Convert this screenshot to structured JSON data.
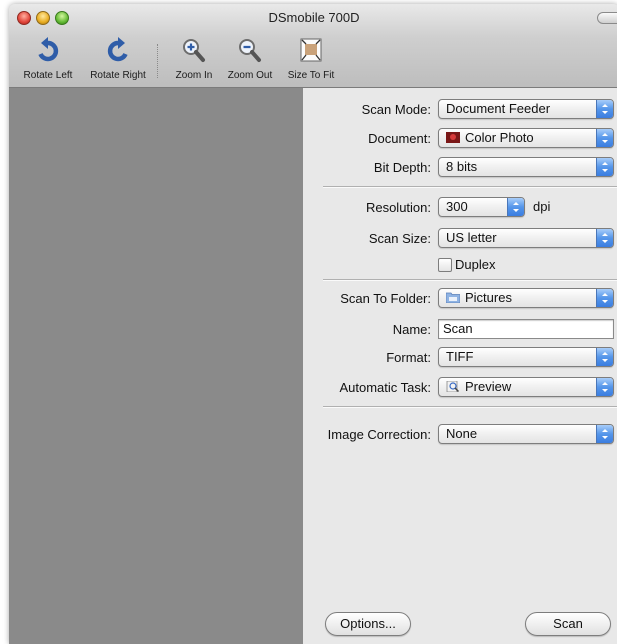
{
  "window": {
    "title": "DSmobile 700D"
  },
  "toolbar": {
    "rotate_left": "Rotate Left",
    "rotate_right": "Rotate Right",
    "zoom_in": "Zoom In",
    "zoom_out": "Zoom Out",
    "size_to_fit": "Size To Fit"
  },
  "settings": {
    "scan_mode": {
      "label": "Scan Mode:",
      "value": "Document Feeder"
    },
    "document": {
      "label": "Document:",
      "value": "Color Photo",
      "icon": "color-photo-icon"
    },
    "bit_depth": {
      "label": "Bit Depth:",
      "value": "8 bits"
    },
    "resolution": {
      "label": "Resolution:",
      "value": "300",
      "unit": "dpi"
    },
    "scan_size": {
      "label": "Scan Size:",
      "value": "US letter"
    },
    "duplex": {
      "label": "Duplex",
      "checked": false
    },
    "scan_to_folder": {
      "label": "Scan To Folder:",
      "value": "Pictures",
      "icon": "folder-icon"
    },
    "name": {
      "label": "Name:",
      "value": "Scan"
    },
    "format": {
      "label": "Format:",
      "value": "TIFF"
    },
    "automatic_task": {
      "label": "Automatic Task:",
      "value": "Preview",
      "icon": "preview-app-icon"
    },
    "image_correction": {
      "label": "Image Correction:",
      "value": "None"
    }
  },
  "buttons": {
    "options": "Options...",
    "scan": "Scan"
  },
  "colors": {
    "accent": "#5596ea",
    "preview_bg": "#8a8a8a",
    "panel_bg": "#e8e8e8"
  }
}
